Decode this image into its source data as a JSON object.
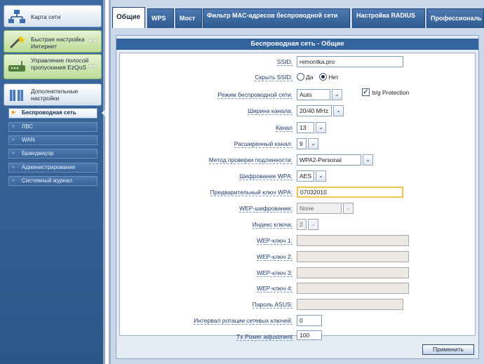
{
  "sidebar": {
    "big_items": [
      {
        "label": "Карта сети",
        "icon": "network-map-icon"
      },
      {
        "label": "Быстрая настройка Интернет",
        "icon": "wizard-wand-icon"
      },
      {
        "label": "Управление полосой пропускания EzQoS",
        "icon": "bandwidth-router-icon"
      },
      {
        "label": "Дополнительные настройки",
        "icon": "advanced-settings-icon"
      }
    ],
    "sub_items": [
      {
        "label": "Беспроводная сеть",
        "active": true
      },
      {
        "label": "ЛВС"
      },
      {
        "label": "WAN"
      },
      {
        "label": "Брандмауэр"
      },
      {
        "label": "Администрирование"
      },
      {
        "label": "Системный журнал"
      }
    ]
  },
  "tabs": [
    {
      "label": "Общие",
      "active": true
    },
    {
      "label": "WPS"
    },
    {
      "label": "Мост"
    },
    {
      "label": "Фильтр MAC-адресов беспроводной сети"
    },
    {
      "label": "Настройка RADIUS"
    },
    {
      "label": "Профессиональ"
    }
  ],
  "panel": {
    "title": "Беспроводная сеть - Общие",
    "ssid": {
      "label": "SSID:",
      "value": "remontka.pro"
    },
    "hide_ssid": {
      "label": "Скрыть SSID:",
      "yes": "Да",
      "no": "Нет",
      "selected": "no"
    },
    "mode": {
      "label": "Режим беспроводной сети:",
      "value": "Auto",
      "protection_label": "b/g Protection",
      "protection_checked": true
    },
    "channel_width": {
      "label": "Ширина канала:",
      "value": "20/40 MHz"
    },
    "channel": {
      "label": "Канал",
      "value": "13"
    },
    "ext_channel": {
      "label": "Расширенный канал:",
      "value": "9"
    },
    "auth_method": {
      "label": "Метод проверки подлинности:",
      "value": "WPA2-Personal"
    },
    "wpa_encryption": {
      "label": "Шифрование WPA:",
      "value": "AES"
    },
    "wpa_key": {
      "label": "Предварительный ключ WPA:",
      "value": "07032010"
    },
    "wep_encryption": {
      "label": "WEP-шифрование:",
      "value": "None"
    },
    "key_index": {
      "label": "Индекс ключа:",
      "value": "2"
    },
    "wep_key1": {
      "label": "WEP-ключ 1:",
      "value": ""
    },
    "wep_key2": {
      "label": "WEP-ключ 2:",
      "value": ""
    },
    "wep_key3": {
      "label": "WEP-ключ 3:",
      "value": ""
    },
    "wep_key4": {
      "label": "WEP-ключ 4:",
      "value": ""
    },
    "asus_pass": {
      "label": "Пароль ASUS:",
      "value": ""
    },
    "rotation": {
      "label": "Интервал ротации сетевых ключей:",
      "value": "0"
    },
    "tx_power": {
      "label": "Tx Power adjustment",
      "value": "100"
    },
    "apply_label": "Применить"
  },
  "colors": {
    "accent": "#34649d",
    "sidebar_bg": "#2c5688",
    "focus_border": "#f5c34a"
  }
}
